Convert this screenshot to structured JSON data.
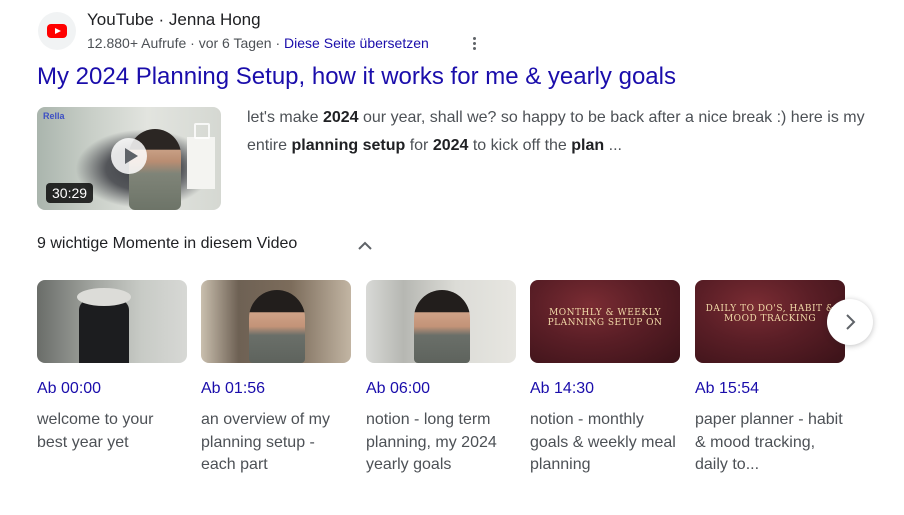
{
  "header": {
    "source": "YouTube · Jenna Hong",
    "views": "12.880+ Aufrufe · vor 6 Tagen · ",
    "translate": "Diese Seite übersetzen"
  },
  "result": {
    "title": "My 2024 Planning Setup, how it works for me & yearly goals",
    "duration": "30:29",
    "thumb_logo": "Rella",
    "snippet": [
      {
        "t": "let's make ",
        "b": false
      },
      {
        "t": "2024",
        "b": true
      },
      {
        "t": " our year, shall we? so happy to be back after a nice break :) here is my entire ",
        "b": false
      },
      {
        "t": "planning setup",
        "b": true
      },
      {
        "t": " for ",
        "b": false
      },
      {
        "t": "2024",
        "b": true
      },
      {
        "t": " to kick off the ",
        "b": false
      },
      {
        "t": "plan",
        "b": true
      },
      {
        "t": " ...",
        "b": false
      }
    ]
  },
  "moments": {
    "header": "9 wichtige Momente in diesem Video",
    "items": [
      {
        "time": "Ab 00:00",
        "desc": "welcome to your best year yet"
      },
      {
        "time": "Ab 01:56",
        "desc": "an overview of my planning setup - each part"
      },
      {
        "time": "Ab 06:00",
        "desc": "notion - long term planning, my 2024 yearly goals"
      },
      {
        "time": "Ab 14:30",
        "desc": "notion - monthly goals & weekly meal planning",
        "overlay": "MONTHLY & WEEKLY PLANNING SETUP ON"
      },
      {
        "time": "Ab 15:54",
        "desc": "paper planner - habit & mood tracking, daily to...",
        "overlay": "DAILY TO DO'S, HABIT & MOOD TRACKING"
      }
    ]
  },
  "colors": {
    "link": "#1a0dab",
    "text": "#202124",
    "muted": "#4d5156",
    "youtube_red": "#ff0000"
  },
  "icons": [
    "youtube-icon",
    "more-vert-icon",
    "play-icon",
    "chevron-up-icon",
    "chevron-right-icon"
  ]
}
